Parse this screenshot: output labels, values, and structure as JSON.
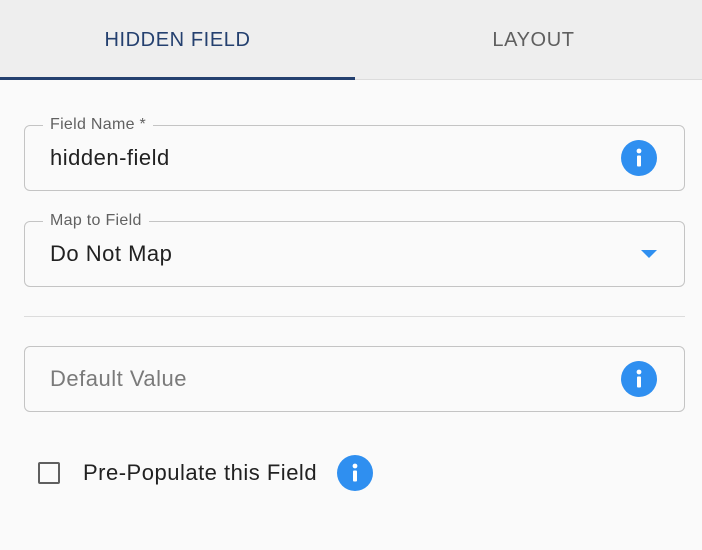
{
  "tabs": {
    "hidden_field": "HIDDEN FIELD",
    "layout": "LAYOUT"
  },
  "fields": {
    "field_name": {
      "label": "Field Name *",
      "value": "hidden-field"
    },
    "map_to_field": {
      "label": "Map to Field",
      "value": "Do Not Map"
    },
    "default_value": {
      "placeholder": "Default Value",
      "value": ""
    }
  },
  "prepopulate": {
    "label": "Pre-Populate this Field",
    "checked": false
  },
  "icons": {
    "info": "info-icon",
    "dropdown": "chevron-down-icon",
    "checkbox": "checkbox-unchecked"
  },
  "colors": {
    "active_tab": "#24406f",
    "accent": "#2f8ff0",
    "tab_background": "#eeeeee"
  }
}
